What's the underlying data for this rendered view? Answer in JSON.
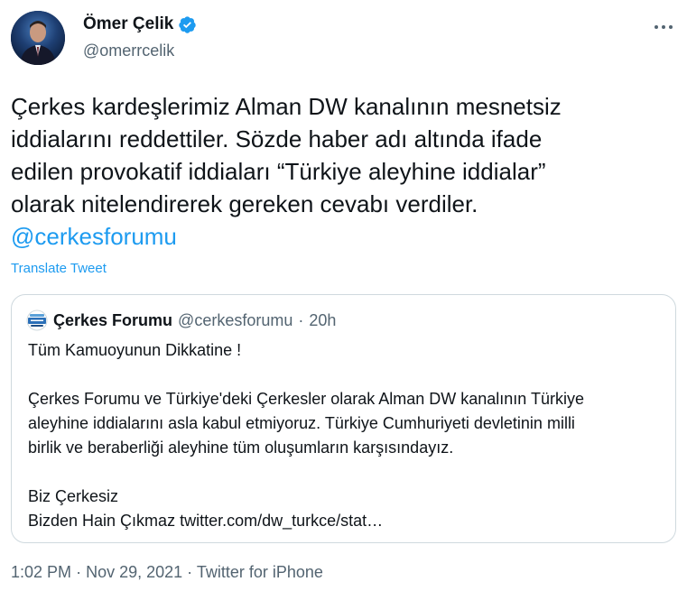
{
  "author": {
    "display_name": "Ömer Çelik",
    "handle": "@omerrcelik",
    "verified": true,
    "avatar_icon": "profile-photo-icon"
  },
  "tweet": {
    "text_lines": [
      "Çerkes kardeşlerimiz Alman DW kanalının mesnetsiz",
      "iddialarını reddettiler. Sözde haber adı altında ifade",
      "edilen provokatif iddiaları “Türkiye aleyhine iddialar”",
      "olarak nitelendirerek gereken cevabı verdiler."
    ],
    "mention": "@cerkesforumu",
    "translate_label": "Translate Tweet"
  },
  "quoted_tweet": {
    "display_name": "Çerkes Forumu",
    "handle": "@cerkesforumu",
    "separator": "·",
    "time": "20h",
    "avatar_icon": "cerkes-forumu-logo-icon",
    "lines": [
      "Tüm Kamuoyunun Dikkatine !",
      "",
      "Çerkes Forumu ve Türkiye'deki Çerkesler  olarak Alman DW kanalının Türkiye",
      "aleyhine iddialarını asla kabul etmiyoruz.  Türkiye Cumhuriyeti devletinin  milli",
      "birlik ve beraberliği aleyhine  tüm oluşumların karşısındayız.",
      "",
      "Biz Çerkesiz",
      "Bizden Hain Çıkmaz twitter.com/dw_turkce/stat…"
    ]
  },
  "meta": {
    "time": "1:02 PM",
    "separator": "·",
    "date": "Nov 29, 2021",
    "source": "Twitter for iPhone"
  },
  "colors": {
    "accent": "#1d9bf0",
    "text": "#0f1419",
    "secondary": "#536471",
    "border": "#cfd9de"
  }
}
